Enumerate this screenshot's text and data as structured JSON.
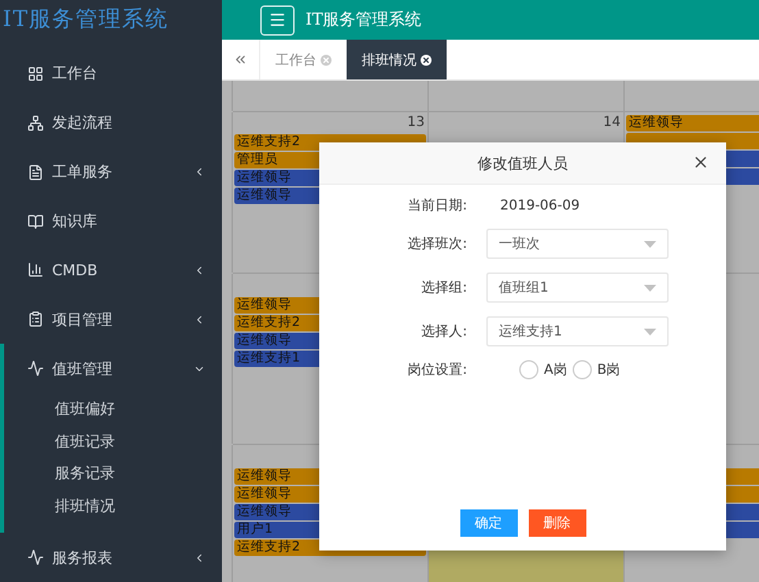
{
  "sidebar": {
    "logo": "IT服务管理系统",
    "items": [
      {
        "label": "工作台"
      },
      {
        "label": "发起流程"
      },
      {
        "label": "工单服务",
        "expanded": false
      },
      {
        "label": "知识库"
      },
      {
        "label": "CMDB",
        "expanded": false
      },
      {
        "label": "项目管理",
        "expanded": false
      },
      {
        "label": "值班管理",
        "expanded": true,
        "selected": true,
        "children": [
          {
            "label": "值班偏好"
          },
          {
            "label": "值班记录"
          },
          {
            "label": "服务记录"
          },
          {
            "label": "排班情况"
          }
        ]
      },
      {
        "label": "服务报表",
        "expanded": false
      }
    ]
  },
  "header": {
    "title": "IT服务管理系统"
  },
  "tabs": [
    {
      "label": "工作台",
      "selected": false
    },
    {
      "label": "排班情况",
      "selected": true
    }
  ],
  "calendar": {
    "weeks": [
      {
        "days": [
          {
            "number": "13",
            "events": [
              {
                "text": "运维支持2",
                "color": "#b87a00"
              },
              {
                "text": "管理员",
                "color": "#b87a00"
              },
              {
                "text": "运维领导",
                "color": "#2c4aa0"
              },
              {
                "text": "运维领导",
                "color": "#2c4aa0"
              }
            ]
          },
          {
            "number": "14"
          },
          {
            "events": [
              {
                "text": "运维领导",
                "color": "#b87a00"
              },
              {
                "color": "#b87a00"
              },
              {
                "color": "#2c4aa0"
              },
              {
                "color": "#2c4aa0"
              }
            ]
          }
        ]
      },
      {
        "days": [
          {
            "events": [
              {
                "text": "运维领导",
                "color": "#b87a00"
              },
              {
                "text": "运维支持2",
                "color": "#b87a00"
              },
              {
                "text": "运维领导",
                "color": "#2c4aa0"
              },
              {
                "text": "运维支持1",
                "color": "#2c4aa0"
              }
            ]
          }
        ]
      },
      {
        "days": [
          {
            "events": [
              {
                "text": "运维领导",
                "color": "#b87a00"
              },
              {
                "text": "运维领导",
                "color": "#b87a00"
              },
              {
                "text": "运维领导",
                "color": "#2c4aa0"
              },
              {
                "text": "用户1",
                "color": "#2c4aa0"
              },
              {
                "text": "运维支持2",
                "color": "#b87a00"
              }
            ]
          },
          {
            "today": true
          },
          {
            "events": [
              {
                "color": "#b87a00"
              },
              {
                "color": "#b87a00"
              },
              {
                "color": "#2c4aa0"
              },
              {
                "color": "#2c4aa0"
              }
            ]
          }
        ]
      }
    ]
  },
  "dialog": {
    "title": "修改值班人员",
    "date_label": "当前日期:",
    "date": "2019-06-09",
    "fields": [
      {
        "label": "选择班次:",
        "value": "一班次"
      },
      {
        "label": "选择组:",
        "value": "值班组1"
      },
      {
        "label": "选择人:",
        "value": "运维支持1"
      }
    ],
    "post": {
      "label": "岗位设置:",
      "options": [
        {
          "label": "A岗",
          "selected": false
        },
        {
          "label": "B岗",
          "selected": false
        }
      ]
    },
    "buttons": [
      {
        "label": "确定",
        "kind": "primary"
      },
      {
        "label": "删除",
        "kind": "danger"
      }
    ]
  }
}
